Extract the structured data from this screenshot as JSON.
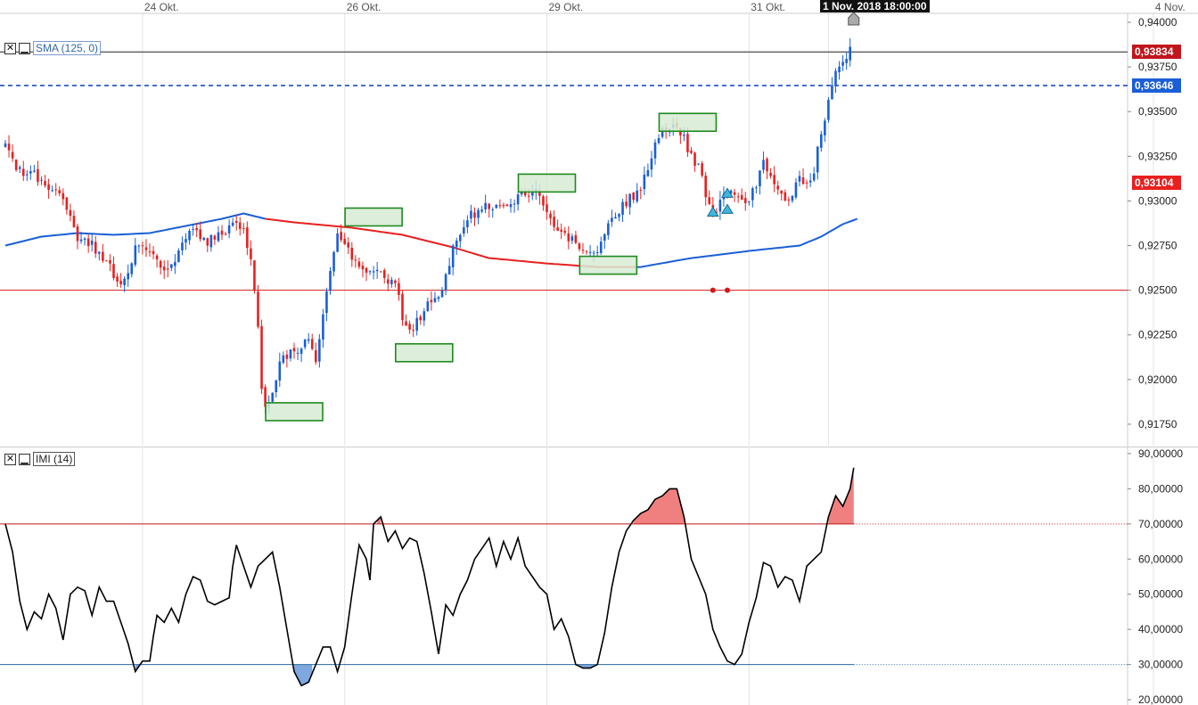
{
  "x_axis": {
    "labels": [
      {
        "text": "24 Okt.",
        "idx": 38
      },
      {
        "text": "26 Okt.",
        "idx": 94
      },
      {
        "text": "29 Okt.",
        "idx": 150
      },
      {
        "text": "31 Okt.",
        "idx": 206
      },
      {
        "text": "4 Nov.",
        "idx": 318
      }
    ],
    "crosshair_label": "1 Nov. 2018 18:00:00"
  },
  "price_panel": {
    "legend_label": "SMA (125, 0)",
    "badges": [
      {
        "text": "0,93834",
        "value": 0.93834,
        "color": "#c0161c"
      },
      {
        "text": "0,93646",
        "value": 0.93646,
        "color": "#1a5fd6"
      },
      {
        "text": "0,93104",
        "value": 0.93104,
        "color": "#e8201f"
      }
    ],
    "y_ticks": [
      "0,94000",
      "0,93750",
      "0,93500",
      "0,93250",
      "0,93000",
      "0,92750",
      "0,92500",
      "0,92250",
      "0,92000",
      "0,91750"
    ],
    "colors": {
      "up": "#1a5fd6",
      "down": "#e8201f",
      "sma_up": "#1a5fd6",
      "sma_down": "#e8201f",
      "box_fill": "#d7ebd3",
      "box_stroke": "#1e8a1e"
    }
  },
  "imi_panel": {
    "legend_label": "IMI (14)",
    "y_ticks": [
      "90,00000",
      "80,00000",
      "70,00000",
      "60,00000",
      "50,00000",
      "40,00000",
      "30,00000",
      "20,00000"
    ],
    "upper_level": 70,
    "lower_level": 30
  },
  "chart_data": [
    {
      "type": "candlestick",
      "name": "SMA (125, 0)",
      "ylim": [
        0.9163,
        0.9405
      ],
      "reference_lines": {
        "last_price": 0.93834,
        "sma_value": 0.93646,
        "support": 0.925
      },
      "close_anchors": [
        [
          0,
          0.9331
        ],
        [
          4,
          0.9316
        ],
        [
          8,
          0.9314
        ],
        [
          12,
          0.9305
        ],
        [
          16,
          0.9302
        ],
        [
          20,
          0.928
        ],
        [
          24,
          0.9275
        ],
        [
          28,
          0.9265
        ],
        [
          32,
          0.9253
        ],
        [
          34,
          0.9258
        ],
        [
          36,
          0.9276
        ],
        [
          40,
          0.9273
        ],
        [
          44,
          0.9262
        ],
        [
          48,
          0.927
        ],
        [
          52,
          0.9285
        ],
        [
          56,
          0.9277
        ],
        [
          60,
          0.9282
        ],
        [
          64,
          0.929
        ],
        [
          66,
          0.9283
        ],
        [
          68,
          0.927
        ],
        [
          70,
          0.923
        ],
        [
          71,
          0.9195
        ],
        [
          72,
          0.9185
        ],
        [
          74,
          0.9192
        ],
        [
          76,
          0.921
        ],
        [
          80,
          0.9216
        ],
        [
          84,
          0.9222
        ],
        [
          86,
          0.921
        ],
        [
          88,
          0.9235
        ],
        [
          90,
          0.926
        ],
        [
          92,
          0.928
        ],
        [
          96,
          0.9268
        ],
        [
          100,
          0.9262
        ],
        [
          104,
          0.9258
        ],
        [
          108,
          0.9255
        ],
        [
          110,
          0.9235
        ],
        [
          112,
          0.9225
        ],
        [
          114,
          0.9232
        ],
        [
          116,
          0.924
        ],
        [
          120,
          0.9245
        ],
        [
          122,
          0.9258
        ],
        [
          124,
          0.9275
        ],
        [
          126,
          0.9283
        ],
        [
          128,
          0.929
        ],
        [
          132,
          0.9296
        ],
        [
          136,
          0.9298
        ],
        [
          140,
          0.93
        ],
        [
          144,
          0.9305
        ],
        [
          148,
          0.9304
        ],
        [
          150,
          0.9292
        ],
        [
          154,
          0.9282
        ],
        [
          158,
          0.9277
        ],
        [
          160,
          0.9272
        ],
        [
          164,
          0.9272
        ],
        [
          166,
          0.928
        ],
        [
          168,
          0.929
        ],
        [
          172,
          0.93
        ],
        [
          176,
          0.9306
        ],
        [
          178,
          0.9318
        ],
        [
          180,
          0.933
        ],
        [
          182,
          0.934
        ],
        [
          186,
          0.9342
        ],
        [
          188,
          0.9335
        ],
        [
          190,
          0.9325
        ],
        [
          192,
          0.9318
        ],
        [
          194,
          0.9305
        ],
        [
          196,
          0.9292
        ],
        [
          198,
          0.93
        ],
        [
          202,
          0.9305
        ],
        [
          206,
          0.93
        ],
        [
          208,
          0.931
        ],
        [
          210,
          0.932
        ],
        [
          212,
          0.9315
        ],
        [
          214,
          0.9305
        ],
        [
          216,
          0.93
        ],
        [
          218,
          0.9305
        ],
        [
          220,
          0.9312
        ],
        [
          222,
          0.9308
        ],
        [
          224,
          0.9318
        ],
        [
          226,
          0.9338
        ],
        [
          228,
          0.9356
        ],
        [
          230,
          0.937
        ],
        [
          232,
          0.9378
        ],
        [
          234,
          0.9385
        ]
      ],
      "sma_anchors": [
        [
          0,
          0.9275
        ],
        [
          10,
          0.928
        ],
        [
          20,
          0.9282
        ],
        [
          30,
          0.9281
        ],
        [
          40,
          0.9282
        ],
        [
          50,
          0.9286
        ],
        [
          60,
          0.929
        ],
        [
          66,
          0.9293
        ],
        [
          72,
          0.929
        ],
        [
          80,
          0.9288
        ],
        [
          96,
          0.9285
        ],
        [
          110,
          0.9281
        ],
        [
          124,
          0.9274
        ],
        [
          134,
          0.9268
        ],
        [
          150,
          0.9265
        ],
        [
          164,
          0.9263
        ],
        [
          176,
          0.9263
        ],
        [
          190,
          0.9268
        ],
        [
          206,
          0.9272
        ],
        [
          220,
          0.9275
        ],
        [
          226,
          0.928
        ],
        [
          232,
          0.9287
        ],
        [
          236,
          0.929
        ]
      ],
      "sma_red_range": [
        72,
        174
      ],
      "marked_boxes": [
        {
          "center_idx": 80,
          "price": 0.9182,
          "level": "low"
        },
        {
          "center_idx": 102,
          "price": 0.9291,
          "level": "high"
        },
        {
          "center_idx": 116,
          "price": 0.9215,
          "level": "low"
        },
        {
          "center_idx": 150,
          "price": 0.931,
          "level": "high"
        },
        {
          "center_idx": 167,
          "price": 0.9264,
          "level": "low"
        },
        {
          "center_idx": 189,
          "price": 0.9344,
          "level": "high"
        }
      ],
      "signal_markers": [
        196,
        200,
        200
      ],
      "support_markers": [
        196,
        200
      ]
    },
    {
      "type": "line",
      "name": "IMI (14)",
      "ylim": [
        18.5,
        91.5
      ],
      "levels": [
        70,
        30
      ],
      "points": [
        [
          0,
          70
        ],
        [
          2,
          62
        ],
        [
          4,
          48
        ],
        [
          6,
          40
        ],
        [
          8,
          45
        ],
        [
          10,
          43
        ],
        [
          12,
          50
        ],
        [
          14,
          46
        ],
        [
          16,
          37
        ],
        [
          18,
          50
        ],
        [
          20,
          52
        ],
        [
          22,
          51
        ],
        [
          24,
          44
        ],
        [
          26,
          52
        ],
        [
          28,
          48
        ],
        [
          30,
          48
        ],
        [
          32,
          42
        ],
        [
          34,
          36
        ],
        [
          36,
          28
        ],
        [
          38,
          31
        ],
        [
          40,
          31
        ],
        [
          41,
          38
        ],
        [
          42,
          44
        ],
        [
          44,
          42
        ],
        [
          46,
          46
        ],
        [
          48,
          42
        ],
        [
          50,
          50
        ],
        [
          52,
          55
        ],
        [
          54,
          54
        ],
        [
          56,
          48
        ],
        [
          58,
          47
        ],
        [
          60,
          48
        ],
        [
          62,
          49
        ],
        [
          63,
          58
        ],
        [
          64,
          64
        ],
        [
          66,
          58
        ],
        [
          68,
          52
        ],
        [
          70,
          58
        ],
        [
          72,
          60
        ],
        [
          74,
          62
        ],
        [
          76,
          52
        ],
        [
          78,
          40
        ],
        [
          80,
          28
        ],
        [
          82,
          24
        ],
        [
          84,
          25
        ],
        [
          86,
          30
        ],
        [
          88,
          35
        ],
        [
          90,
          35
        ],
        [
          92,
          28
        ],
        [
          94,
          35
        ],
        [
          96,
          50
        ],
        [
          98,
          64
        ],
        [
          100,
          60
        ],
        [
          101,
          54
        ],
        [
          102,
          70
        ],
        [
          104,
          72
        ],
        [
          106,
          65
        ],
        [
          108,
          68
        ],
        [
          110,
          63
        ],
        [
          112,
          66
        ],
        [
          114,
          65
        ],
        [
          116,
          56
        ],
        [
          118,
          45
        ],
        [
          120,
          33
        ],
        [
          122,
          47
        ],
        [
          124,
          44
        ],
        [
          126,
          50
        ],
        [
          128,
          54
        ],
        [
          130,
          60
        ],
        [
          134,
          66
        ],
        [
          136,
          58
        ],
        [
          138,
          65
        ],
        [
          140,
          60
        ],
        [
          142,
          66
        ],
        [
          144,
          58
        ],
        [
          146,
          55
        ],
        [
          148,
          52
        ],
        [
          150,
          50
        ],
        [
          152,
          40
        ],
        [
          154,
          43
        ],
        [
          156,
          38
        ],
        [
          158,
          30
        ],
        [
          160,
          29
        ],
        [
          162,
          29
        ],
        [
          164,
          30
        ],
        [
          166,
          39
        ],
        [
          168,
          52
        ],
        [
          170,
          62
        ],
        [
          172,
          68
        ],
        [
          174,
          71
        ],
        [
          176,
          73
        ],
        [
          178,
          74
        ],
        [
          180,
          77
        ],
        [
          182,
          78
        ],
        [
          184,
          80
        ],
        [
          186,
          80
        ],
        [
          188,
          72
        ],
        [
          190,
          60
        ],
        [
          192,
          55
        ],
        [
          194,
          50
        ],
        [
          196,
          40
        ],
        [
          198,
          35
        ],
        [
          200,
          31
        ],
        [
          202,
          30
        ],
        [
          204,
          33
        ],
        [
          206,
          42
        ],
        [
          208,
          49
        ],
        [
          210,
          59
        ],
        [
          212,
          58
        ],
        [
          214,
          52
        ],
        [
          216,
          55
        ],
        [
          218,
          54
        ],
        [
          220,
          48
        ],
        [
          222,
          58
        ],
        [
          224,
          60
        ],
        [
          226,
          62
        ],
        [
          228,
          72
        ],
        [
          230,
          78
        ],
        [
          232,
          75
        ],
        [
          234,
          80
        ],
        [
          235,
          86
        ]
      ]
    }
  ]
}
